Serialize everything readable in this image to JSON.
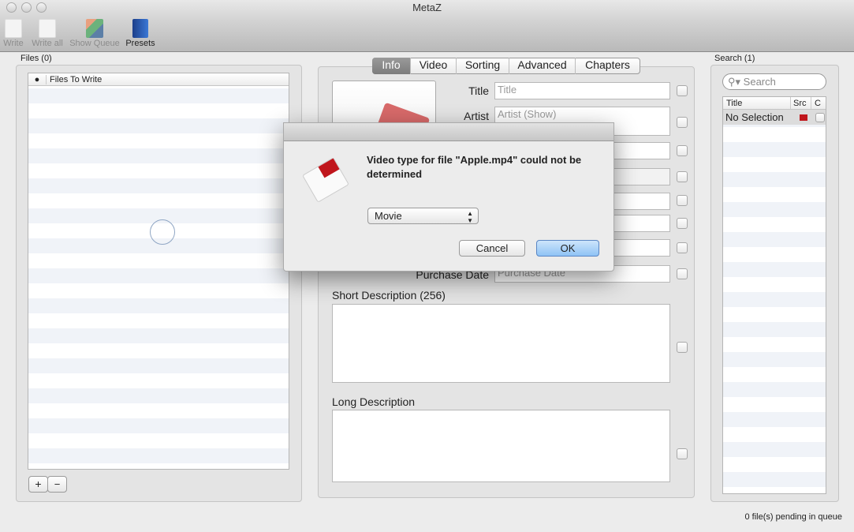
{
  "window": {
    "title": "MetaZ"
  },
  "toolbar": [
    {
      "label": "Write",
      "enabled": false
    },
    {
      "label": "Write all",
      "enabled": false
    },
    {
      "label": "Show Queue",
      "enabled": false
    },
    {
      "label": "Presets",
      "enabled": true
    }
  ],
  "files": {
    "heading": "Files (0)",
    "column": "Files To Write",
    "add": "+",
    "remove": "−"
  },
  "tabs": [
    "Info",
    "Video",
    "Sorting",
    "Advanced",
    "Chapters"
  ],
  "active_tab": "Info",
  "info": {
    "title_label": "Title",
    "title_placeholder": "Title",
    "artist_label": "Artist",
    "artist_placeholder": "Artist (Show)",
    "purchase_label": "Purchase Date",
    "purchase_placeholder": "Purchase Date",
    "short_desc_label": "Short Description (256)",
    "long_desc_label": "Long Description"
  },
  "search": {
    "heading": "Search (1)",
    "placeholder": "Search",
    "columns": [
      "Title",
      "Src",
      "C"
    ],
    "rows": [
      {
        "title": "No Selection"
      }
    ]
  },
  "status": "0 file(s) pending in queue",
  "dialog": {
    "message": "Video type for file \"Apple.mp4\" could not be determined",
    "selected": "Movie",
    "cancel": "Cancel",
    "ok": "OK"
  },
  "colors": {
    "ok_button": "#8fc3f5",
    "active_tab": "#8a8a8a",
    "tag_red": "#c0161c"
  }
}
